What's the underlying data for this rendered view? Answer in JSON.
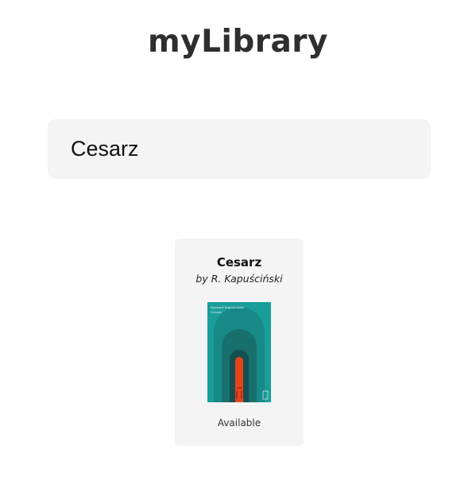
{
  "app": {
    "title": "myLibrary"
  },
  "search": {
    "value": "Cesarz",
    "placeholder": ""
  },
  "results": [
    {
      "title": "Cesarz",
      "author": "by R. Kapuściński",
      "status": "Available",
      "cover": {
        "author_text": "Ryszard Kapuściński",
        "title_text": "Cesarz",
        "colors": {
          "background": "#1a9e9a",
          "arch_outer": "#178a87",
          "arch_mid": "#176f6e",
          "arch_inner": "#14504f",
          "door": "#e8441d"
        }
      }
    }
  ]
}
